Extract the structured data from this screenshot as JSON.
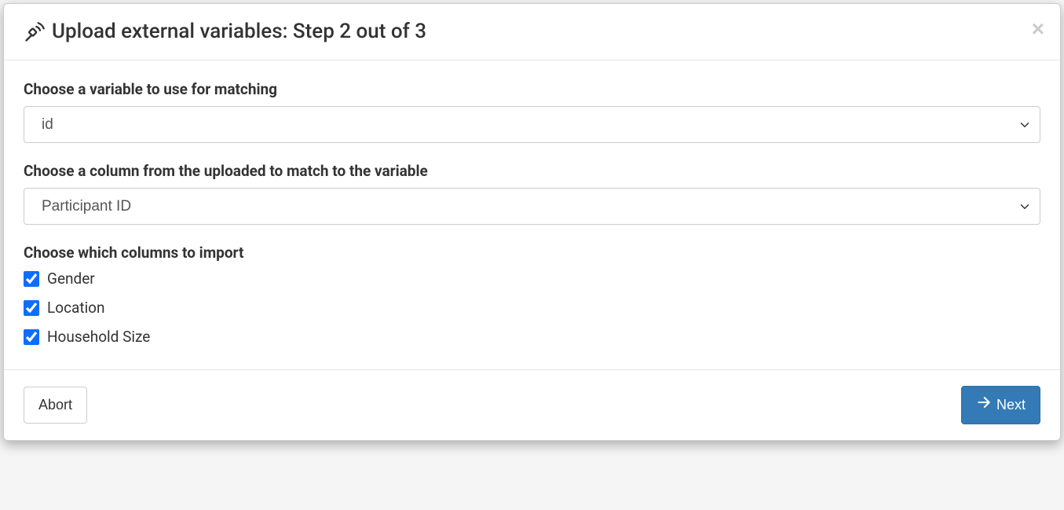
{
  "header": {
    "title": "Upload external variables: Step 2 out of 3"
  },
  "body": {
    "matchVariable": {
      "label": "Choose a variable to use for matching",
      "selected": "id"
    },
    "matchColumn": {
      "label": "Choose a column from the uploaded to match to the variable",
      "selected": "Participant ID"
    },
    "importColumns": {
      "label": "Choose which columns to import",
      "items": [
        {
          "label": "Gender",
          "checked": true
        },
        {
          "label": "Location",
          "checked": true
        },
        {
          "label": "Household Size",
          "checked": true
        }
      ]
    }
  },
  "footer": {
    "abort": "Abort",
    "next": "Next"
  }
}
